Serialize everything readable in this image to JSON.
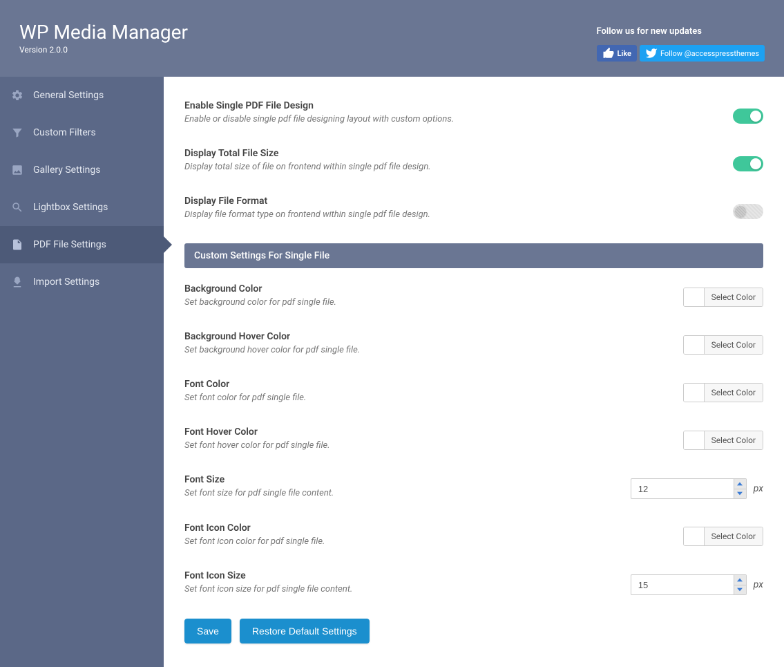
{
  "header": {
    "title": "WP Media Manager",
    "version": "Version 2.0.0",
    "follow_text": "Follow us for new updates",
    "fb_like_label": "Like",
    "tw_follow_label": "Follow @accesspressthemes"
  },
  "sidebar": {
    "items": [
      {
        "label": "General Settings"
      },
      {
        "label": "Custom Filters"
      },
      {
        "label": "Gallery Settings"
      },
      {
        "label": "Lightbox Settings"
      },
      {
        "label": "PDF File Settings"
      },
      {
        "label": "Import Settings"
      }
    ]
  },
  "settings": {
    "enable_single": {
      "title": "Enable Single PDF File Design",
      "desc": "Enable or disable single pdf file designing layout with custom options."
    },
    "display_size": {
      "title": "Display Total File Size",
      "desc": "Display total size of file on frontend within single pdf file design."
    },
    "display_format": {
      "title": "Display File Format",
      "desc": "Display file format type on frontend within single pdf file design."
    },
    "section_header": "Custom Settings For Single File",
    "bg_color": {
      "title": "Background Color",
      "desc": "Set background color for pdf single file."
    },
    "bg_hover": {
      "title": "Background Hover Color",
      "desc": "Set background hover color for pdf single file."
    },
    "font_color": {
      "title": "Font Color",
      "desc": "Set font color for pdf single file."
    },
    "font_hover": {
      "title": "Font Hover Color",
      "desc": "Set font hover color for pdf single file."
    },
    "font_size": {
      "title": "Font Size",
      "desc": "Set font size for pdf single file content.",
      "value": "12",
      "unit": "px"
    },
    "icon_color": {
      "title": "Font Icon Color",
      "desc": "Set font icon color for pdf single file."
    },
    "icon_size": {
      "title": "Font Icon Size",
      "desc": "Set font icon size for pdf single file content.",
      "value": "15",
      "unit": "px"
    },
    "select_color_label": "Select Color"
  },
  "actions": {
    "save": "Save",
    "restore": "Restore Default Settings"
  }
}
